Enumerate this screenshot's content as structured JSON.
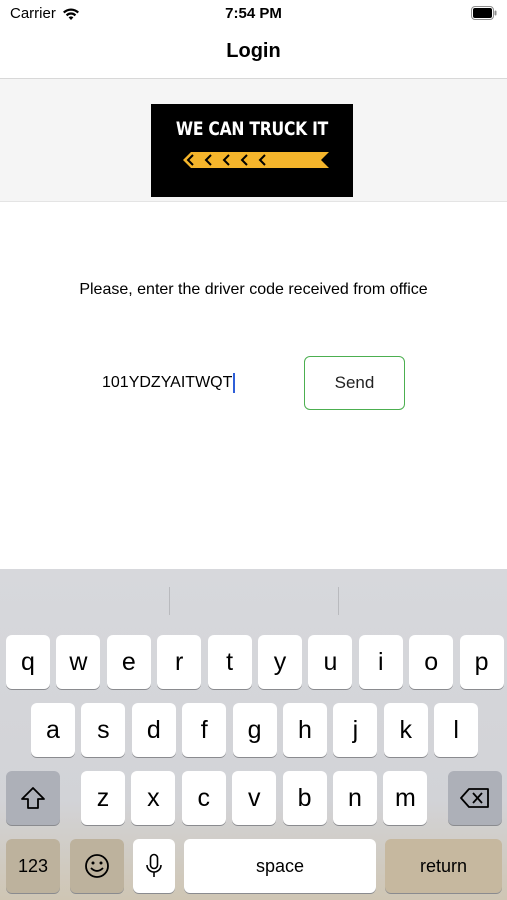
{
  "status_bar": {
    "carrier": "Carrier",
    "time": "7:54 PM"
  },
  "nav": {
    "title": "Login"
  },
  "logo": {
    "text": "WE CAN TRUCK IT",
    "accent_color": "#f5b52b"
  },
  "form": {
    "prompt": "Please, enter the driver code received from office",
    "code_value": "101YDZYAITWQT",
    "send_label": "Send",
    "send_border_color": "#4caf50"
  },
  "keyboard": {
    "row1": [
      "q",
      "w",
      "e",
      "r",
      "t",
      "y",
      "u",
      "i",
      "o",
      "p"
    ],
    "row2": [
      "a",
      "s",
      "d",
      "f",
      "g",
      "h",
      "j",
      "k",
      "l"
    ],
    "row3": [
      "z",
      "x",
      "c",
      "v",
      "b",
      "n",
      "m"
    ],
    "numbers_label": "123",
    "space_label": "space",
    "return_label": "return",
    "icons": {
      "shift": "shift-icon",
      "delete": "delete-icon",
      "emoji": "emoji-icon",
      "mic": "microphone-icon"
    }
  }
}
